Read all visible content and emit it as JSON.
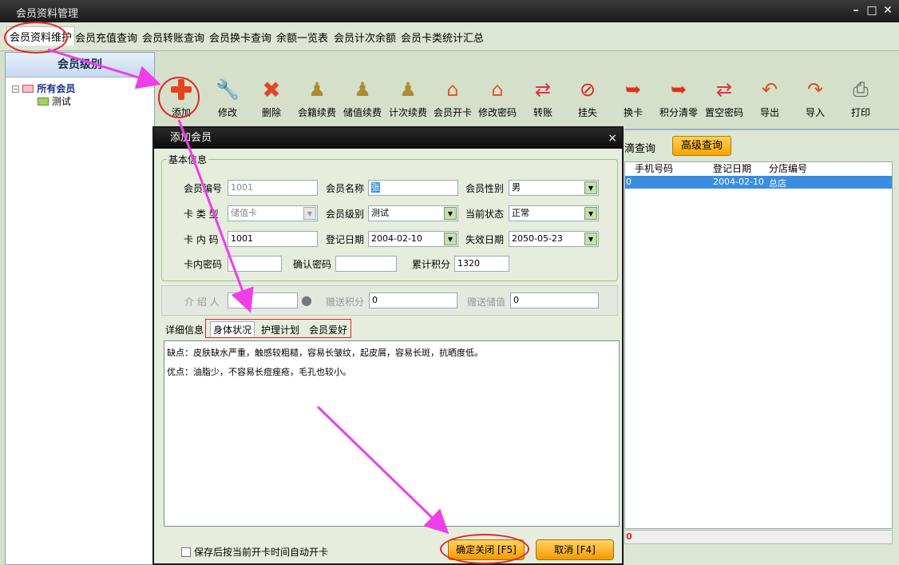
{
  "window": {
    "title": "会员资料管理",
    "min": "–",
    "max": "□",
    "close": "✕"
  },
  "tabs": [
    "会员资料维护",
    "会员充值查询",
    "会员转账查询",
    "会员换卡查询",
    "余额一览表",
    "会员计次余额",
    "会员卡类统计汇总"
  ],
  "sidebar": {
    "header": "会员级别",
    "root": "所有会员",
    "child": "测试"
  },
  "toolbar": [
    {
      "label": "添加",
      "icon": "plus-icon"
    },
    {
      "label": "修改",
      "icon": "wrench-icon"
    },
    {
      "label": "删除",
      "icon": "delete-x-icon"
    },
    {
      "label": "会籍续费",
      "icon": "pawn-icon"
    },
    {
      "label": "储值续费",
      "icon": "pawn-icon"
    },
    {
      "label": "计次续费",
      "icon": "pawn-icon"
    },
    {
      "label": "会员开卡",
      "icon": "house-icon"
    },
    {
      "label": "修改密码",
      "icon": "house-icon"
    },
    {
      "label": "转账",
      "icon": "transfer-icon"
    },
    {
      "label": "挂失",
      "icon": "no-entry-icon"
    },
    {
      "label": "换卡",
      "icon": "swap-arrow-icon"
    },
    {
      "label": "积分清零",
      "icon": "swap-arrow-icon"
    },
    {
      "label": "置空密码",
      "icon": "transfer-icon"
    },
    {
      "label": "导出",
      "icon": "export-icon"
    },
    {
      "label": "导入",
      "icon": "import-icon"
    },
    {
      "label": "打印",
      "icon": "printer-icon"
    }
  ],
  "rightpane": {
    "prefix": "滴查询",
    "advanced_query": "高级查询",
    "headers": [
      "手机号码",
      "登记日期",
      "分店编号"
    ],
    "row": {
      "lead": "0",
      "phone": "",
      "date": "2004-02-10",
      "store": "总店"
    },
    "footer_lead": "0"
  },
  "dialog": {
    "title": "添加会员",
    "close": "×",
    "basic_group": "基本信息",
    "labels": {
      "member_no": "会员编号",
      "member_name": "会员名称",
      "gender": "会员性别",
      "card_type": "卡 类 型",
      "level": "会员级别",
      "status": "当前状态",
      "card_code": "卡 内 码",
      "reg_date": "登记日期",
      "expire_date": "失效日期",
      "card_pwd": "卡内密码",
      "confirm_pwd": "确认密码",
      "points": "累计积分",
      "referrer": "介 绍 人",
      "gift_points": "赠送积分",
      "gift_value": "赠送储值"
    },
    "values": {
      "member_no": "1001",
      "member_name": "张",
      "gender": "男",
      "card_type": "储值卡",
      "level": "测试",
      "status": "正常",
      "card_code": "1001",
      "reg_date": "2004-02-10",
      "expire_date": "2050-05-23",
      "card_pwd": "",
      "confirm_pwd": "",
      "points": "1320",
      "referrer": "",
      "gift_points": "0",
      "gift_value": "0"
    },
    "subtabs": [
      "详细信息",
      "身体状况",
      "护理计划",
      "会员爱好"
    ],
    "memo_lines": [
      "缺点：皮肤缺水严重，触感较粗糙，容易长皱纹，起皮屑，容易长斑，抗晒度低。",
      "优点：油脂少，不容易长痘痤疮，毛孔也较小。"
    ],
    "auto_open_label": "保存后按当前开卡时间自动开卡",
    "ok_button": "确定关闭 [F5]",
    "cancel_button": "取消 [F4]"
  }
}
